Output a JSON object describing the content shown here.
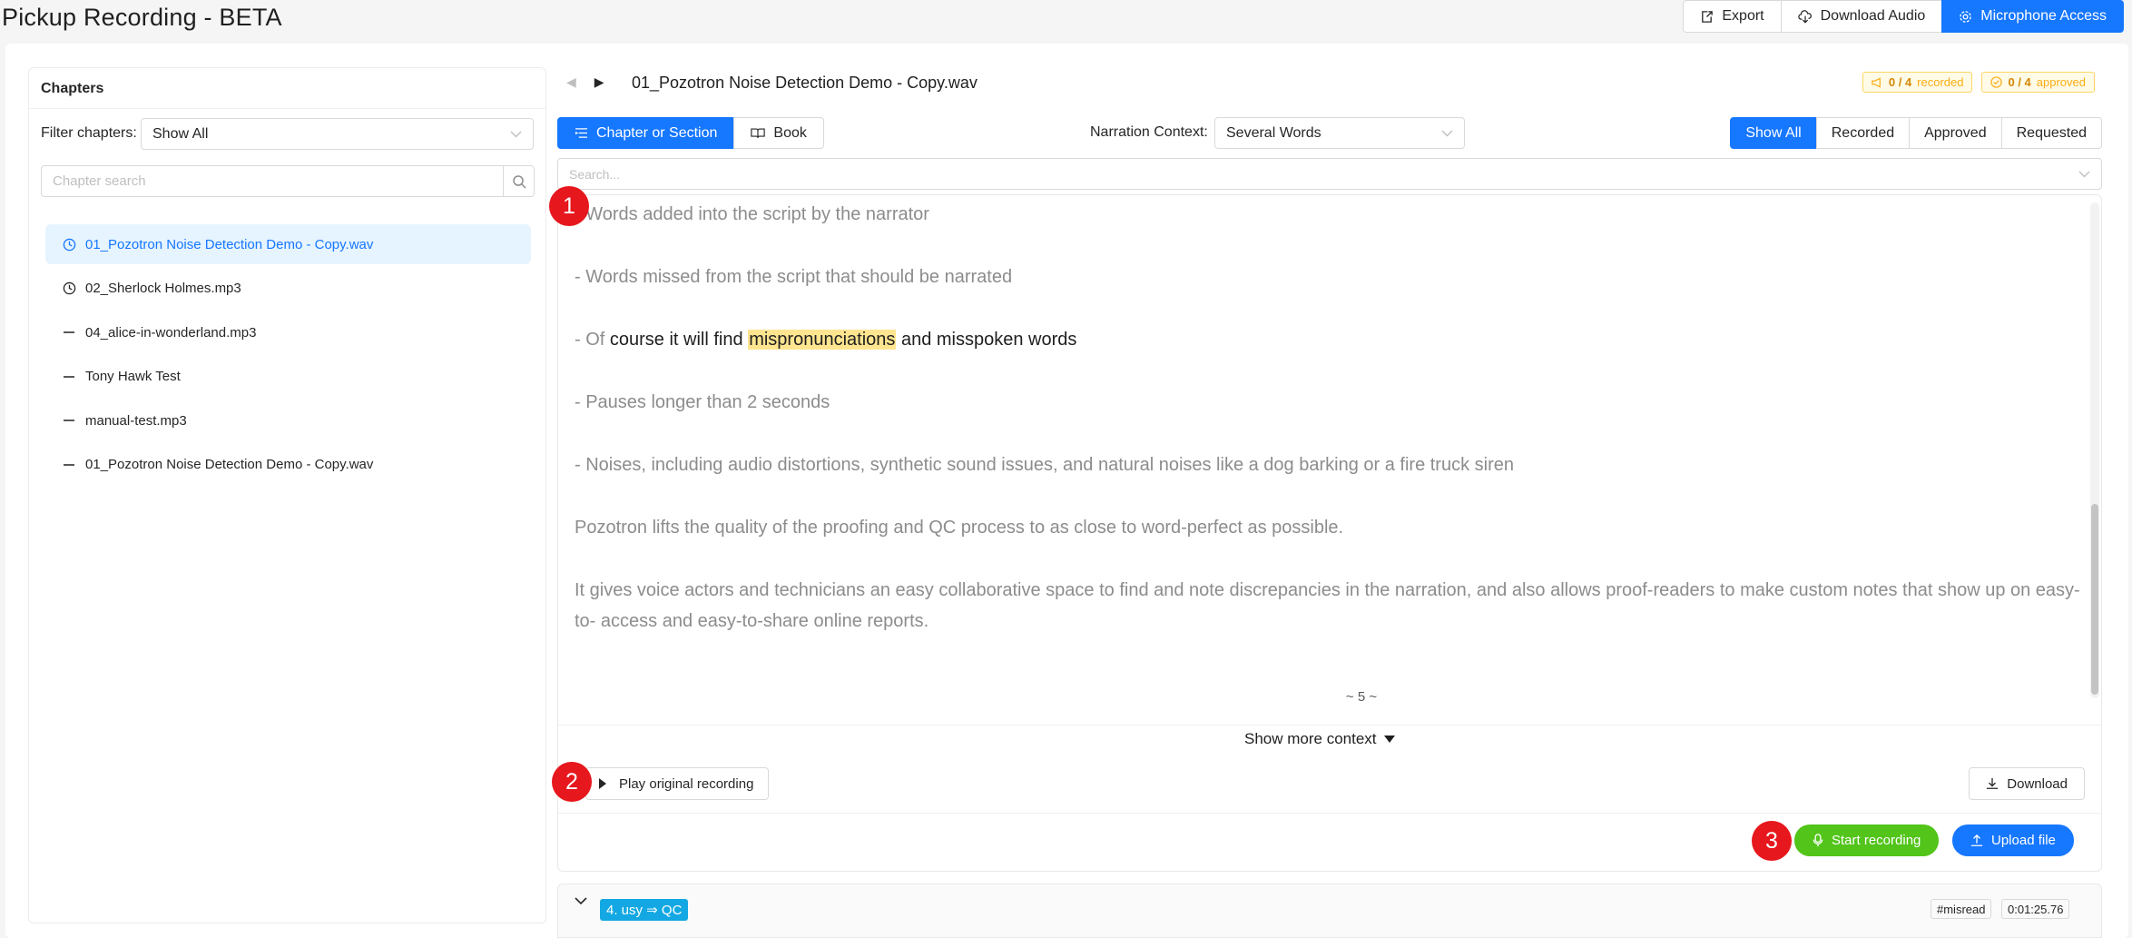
{
  "app": {
    "title": "Pickup Recording - BETA"
  },
  "top_actions": {
    "export": "Export",
    "download_audio": "Download Audio",
    "microphone_access": "Microphone Access"
  },
  "sidebar": {
    "title": "Chapters",
    "filter_label": "Filter chapters:",
    "filter_value": "Show All",
    "search_placeholder": "Chapter search",
    "chapters": [
      {
        "label": "01_Pozotron Noise Detection Demo - Copy.wav",
        "icon": "clock-icon",
        "active": true
      },
      {
        "label": "02_Sherlock Holmes.mp3",
        "icon": "clock-icon",
        "active": false
      },
      {
        "label": "04_alice-in-wonderland.mp3",
        "icon": "dash-icon",
        "active": false
      },
      {
        "label": "Tony Hawk Test",
        "icon": "dash-icon",
        "active": false
      },
      {
        "label": "manual-test.mp3",
        "icon": "dash-icon",
        "active": false
      },
      {
        "label": "01_Pozotron Noise Detection Demo - Copy.wav",
        "icon": "dash-icon",
        "active": false
      }
    ]
  },
  "main": {
    "file_title": "01_Pozotron Noise Detection Demo - Copy.wav",
    "badges": {
      "recorded_count": "0 / 4",
      "recorded_label": "recorded",
      "approved_count": "0 / 4",
      "approved_label": "approved"
    },
    "scope_toggle": {
      "chapter": "Chapter or Section",
      "book": "Book"
    },
    "narration_context": {
      "label": "Narration Context:",
      "value": "Several Words"
    },
    "filter_tabs": [
      "Show All",
      "Recorded",
      "Approved",
      "Requested"
    ],
    "search_placeholder": "Search...",
    "script": {
      "p1": "- Words added into the script by the narrator",
      "p2": "- Words missed from the script that should be narrated",
      "p3_prefix": "- Of",
      "p3_dark": " course it will find ",
      "p3_highlight": "mispronunciations",
      "p3_suffix": " and misspoken words",
      "p4": "- Pauses longer than 2 seconds",
      "p5": "- Noises, including audio distortions, synthetic sound issues, and natural noises like a dog barking or a fire truck siren",
      "p6": "Pozotron lifts the quality of the proofing and QC process to as close to word-perfect as possible.",
      "p7": "It gives voice actors and technicians an easy collaborative space to find and note discrepancies in the narration, and also allows proof-readers to make custom notes that show up on easy-to- access and easy-to-share online reports."
    },
    "page_number": "~ 5 ~",
    "show_more": "Show more context",
    "play_original": "Play original recording",
    "download": "Download",
    "start_recording": "Start recording",
    "upload_file": "Upload file",
    "next_item": {
      "tag": "4. usy ⇒ QC",
      "type_tag": "#misread",
      "time_tag": "0:01:25.76"
    }
  },
  "markers": [
    "1",
    "2",
    "3"
  ],
  "colors": {
    "primary": "#1677ff",
    "success": "#52c41a",
    "highlight": "#ffe58f",
    "badge": "#faad14",
    "marker": "#e6171d"
  }
}
